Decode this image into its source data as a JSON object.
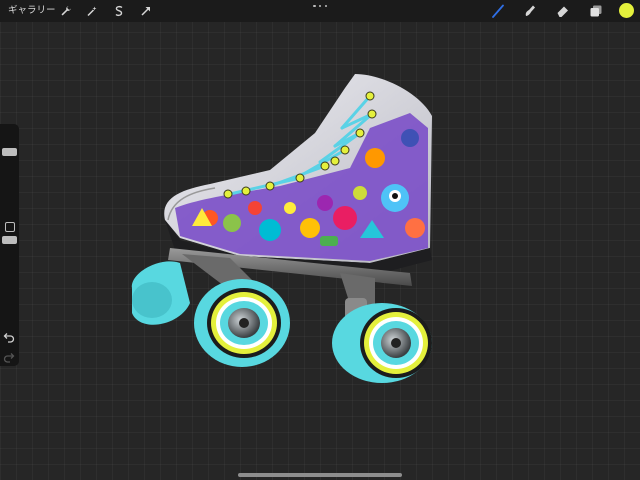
{
  "topbar": {
    "gallery_label": "ギャラリー",
    "left_tools": [
      {
        "icon": "wrench-icon",
        "label": "actions"
      },
      {
        "icon": "magic-wand-icon",
        "label": "adjustments"
      },
      {
        "icon": "selection-icon",
        "label": "selection"
      },
      {
        "icon": "transform-arrow-icon",
        "label": "transform"
      }
    ],
    "more_icon": "more-dots-icon",
    "right_tools": [
      {
        "icon": "brush-icon",
        "active": true
      },
      {
        "icon": "smudge-icon",
        "active": false
      },
      {
        "icon": "eraser-icon",
        "active": false
      },
      {
        "icon": "layers-icon",
        "active": false
      }
    ],
    "current_color": "#e4f03c"
  },
  "sidebar": {
    "brush_size_level": 0.18,
    "opacity_level": 0.5,
    "undo_icon": "undo-icon",
    "redo_icon": "redo-icon"
  },
  "canvas": {
    "artwork": "roller-skate-illustration",
    "colors": {
      "background": "#262626",
      "boot": "#e2e2e6",
      "wheels": "#58d8e0",
      "laces": "#5ad2e6",
      "eyelets": "#e4f03c",
      "active_tool": "#2f6fe6"
    }
  }
}
